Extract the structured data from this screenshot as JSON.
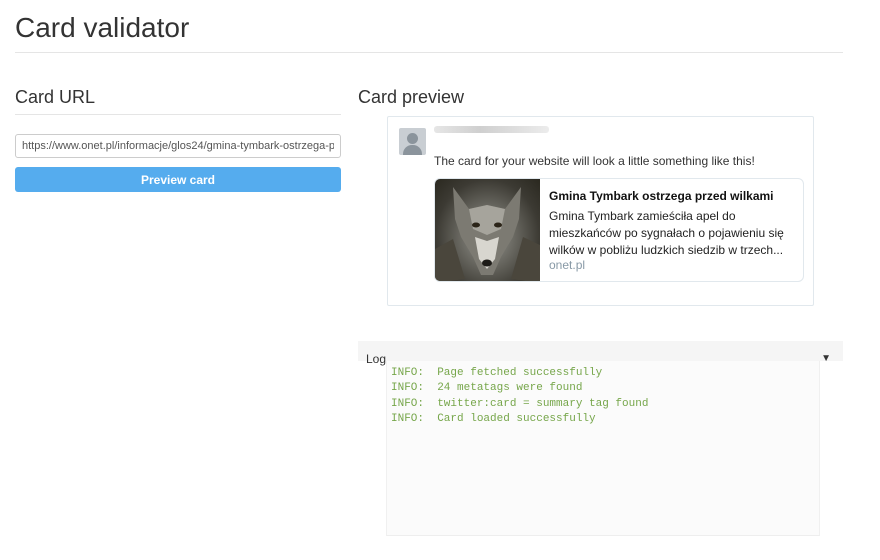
{
  "page": {
    "title": "Card validator"
  },
  "url_section": {
    "heading": "Card URL",
    "input_value": "https://www.onet.pl/informacje/glos24/gmina-tymbark-ostrzega-p",
    "button_label": "Preview card"
  },
  "preview_section": {
    "heading": "Card preview",
    "tweet_text": "The card for your website will look a little something like this!",
    "card": {
      "title": "Gmina Tymbark ostrzega przed wilkami",
      "description": "Gmina Tymbark zamieściła apel do mieszkańców po sygnałach o pojawieniu się wilków w pobliżu ludzkich siedzib w trzech...",
      "domain": "onet.pl",
      "image": "wolf-photo"
    }
  },
  "log": {
    "label": "Log",
    "toggle_icon": "triangle-down-icon",
    "lines": [
      "INFO:  Page fetched successfully",
      "INFO:  24 metatags were found",
      "INFO:  twitter:card = summary tag found",
      "INFO:  Card loaded successfully"
    ]
  },
  "colors": {
    "button": "#55acee",
    "log_text": "#76a64a",
    "card_domain": "#8899a6"
  }
}
